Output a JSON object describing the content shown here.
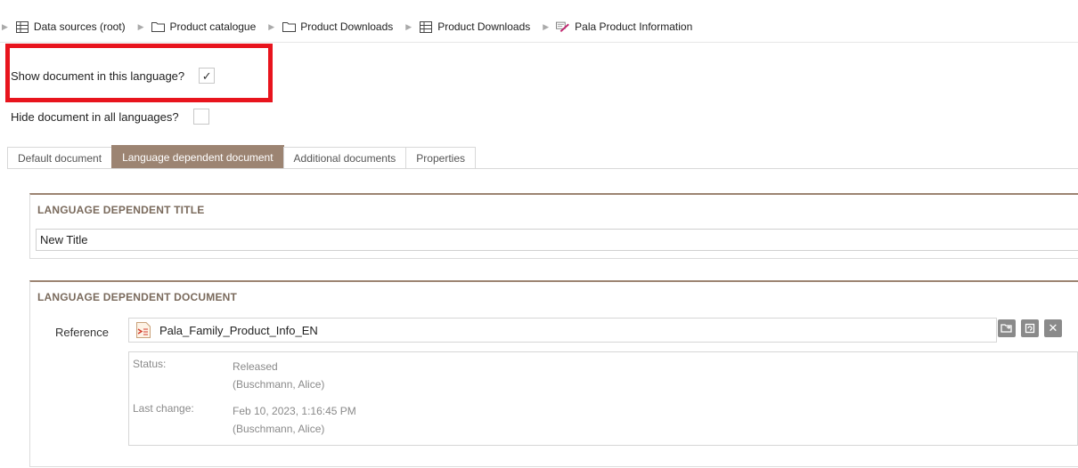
{
  "breadcrumb": [
    {
      "label": "Data sources (root)",
      "icon": "table-icon"
    },
    {
      "label": "Product catalogue",
      "icon": "folder-icon"
    },
    {
      "label": "Product Downloads",
      "icon": "folder-icon"
    },
    {
      "label": "Product Downloads",
      "icon": "table-icon"
    },
    {
      "label": "Pala Product Information",
      "icon": "edit-document-icon"
    }
  ],
  "options": {
    "show_label": "Show document in this language?",
    "show_checked": "✓",
    "hide_label": "Hide document in all languages?",
    "hide_checked": ""
  },
  "tabs": [
    {
      "label": "Default document",
      "active": false
    },
    {
      "label": "Language dependent document",
      "active": true
    },
    {
      "label": "Additional documents",
      "active": false
    },
    {
      "label": "Properties",
      "active": false
    }
  ],
  "title_panel": {
    "heading": "LANGUAGE DEPENDENT TITLE",
    "value": "New Title"
  },
  "doc_panel": {
    "heading": "LANGUAGE DEPENDENT DOCUMENT",
    "reference_label": "Reference",
    "reference_value": "Pala_Family_Product_Info_EN",
    "actions": [
      "open-icon",
      "replace-icon",
      "remove-icon"
    ],
    "status_label": "Status:",
    "status_value": "Released",
    "status_user": "(Buschmann, Alice)",
    "last_change_label": "Last change:",
    "last_change_value": "Feb 10, 2023, 1:16:45 PM",
    "last_change_user": "(Buschmann, Alice)"
  },
  "colors": {
    "accent": "#9c8472",
    "highlight": "#e8141d"
  }
}
